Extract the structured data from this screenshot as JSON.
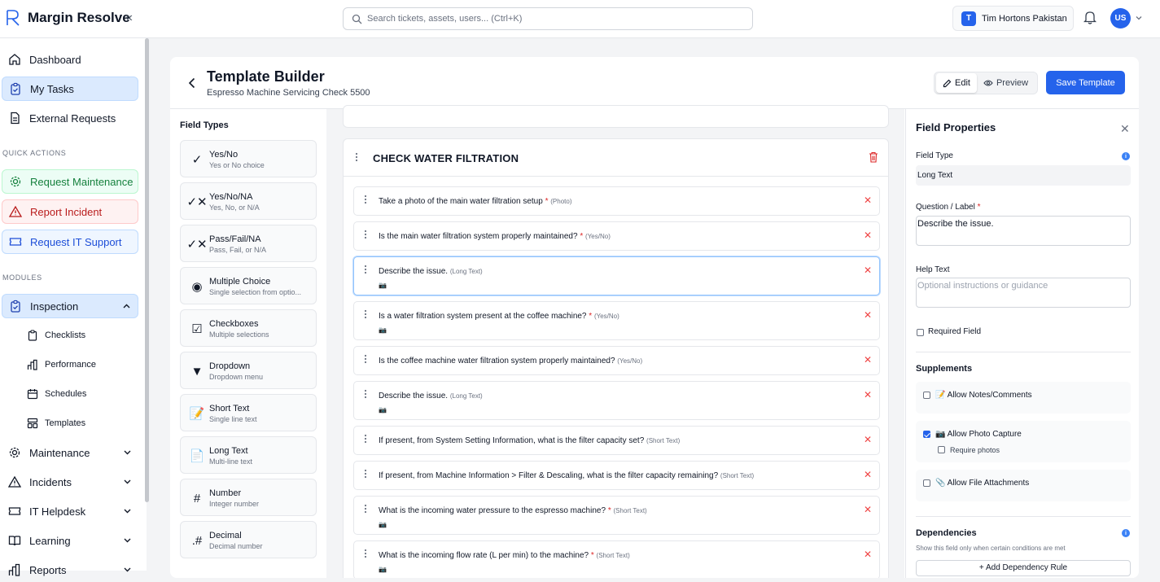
{
  "app": {
    "name": "Margin Resolve",
    "collapse_glyph": "«"
  },
  "search": {
    "placeholder": "Search tickets, assets, users... (Ctrl+K)"
  },
  "org": {
    "initial": "T",
    "name": "Tim Hortons Pakistan"
  },
  "user": {
    "initials": "US"
  },
  "sidebar": {
    "items": [
      {
        "label": "Dashboard",
        "icon": "home-icon"
      },
      {
        "label": "My Tasks",
        "icon": "clipboard-icon",
        "active": true
      },
      {
        "label": "External Requests",
        "icon": "document-icon"
      }
    ],
    "quick_actions_header": "QUICK ACTIONS",
    "quick_actions": [
      {
        "label": "Request Maintenance",
        "icon": "gear-icon",
        "color": "#15803d"
      },
      {
        "label": "Report Incident",
        "icon": "warning-icon",
        "color": "#b91c1c"
      },
      {
        "label": "Request IT Support",
        "icon": "ticket-icon",
        "color": "#1d4ed8"
      }
    ],
    "modules_header": "MODULES",
    "inspection": {
      "label": "Inspection",
      "expanded": true
    },
    "inspection_sub": [
      {
        "label": "Checklists",
        "icon": "clipboard-icon"
      },
      {
        "label": "Performance",
        "icon": "bar-chart-icon"
      },
      {
        "label": "Schedules",
        "icon": "calendar-icon"
      },
      {
        "label": "Templates",
        "icon": "layout-icon"
      }
    ],
    "modules": [
      {
        "label": "Maintenance",
        "icon": "gear-icon"
      },
      {
        "label": "Incidents",
        "icon": "warning-icon"
      },
      {
        "label": "IT Helpdesk",
        "icon": "ticket-icon"
      },
      {
        "label": "Learning",
        "icon": "book-icon"
      },
      {
        "label": "Reports",
        "icon": "bar-chart-icon"
      }
    ]
  },
  "builder": {
    "title": "Template Builder",
    "subtitle": "Espresso Machine Servicing Check 5500",
    "edit_label": "Edit",
    "preview_label": "Preview",
    "save_label": "Save Template"
  },
  "field_types": {
    "header": "Field Types",
    "items": [
      {
        "name": "Yes/No",
        "desc": "Yes or No choice",
        "icon": "✓"
      },
      {
        "name": "Yes/No/NA",
        "desc": "Yes, No, or N/A",
        "icon": "✓✕"
      },
      {
        "name": "Pass/Fail/NA",
        "desc": "Pass, Fail, or N/A",
        "icon": "✓✕"
      },
      {
        "name": "Multiple Choice",
        "desc": "Single selection from optio...",
        "icon": "◉"
      },
      {
        "name": "Checkboxes",
        "desc": "Multiple selections",
        "icon": "☑"
      },
      {
        "name": "Dropdown",
        "desc": "Dropdown menu",
        "icon": "▼"
      },
      {
        "name": "Short Text",
        "desc": "Single line text",
        "icon": "📝"
      },
      {
        "name": "Long Text",
        "desc": "Multi-line text",
        "icon": "📄"
      },
      {
        "name": "Number",
        "desc": "Integer number",
        "icon": "#"
      },
      {
        "name": "Decimal",
        "desc": "Decimal number",
        "icon": ".#"
      }
    ]
  },
  "section": {
    "title": "CHECK WATER FILTRATION",
    "questions": [
      {
        "text": "Take a photo of the main water filtration setup",
        "required": true,
        "type": "(Photo)",
        "camera": false
      },
      {
        "text": "Is the main water filtration system properly maintained?",
        "required": true,
        "type": "(Yes/No)",
        "camera": false
      },
      {
        "text": "Describe the issue.",
        "required": false,
        "type": "(Long Text)",
        "camera": true,
        "selected": true
      },
      {
        "text": "Is a water filtration system present at the coffee machine?",
        "required": true,
        "type": "(Yes/No)",
        "camera": true
      },
      {
        "text": "Is the coffee machine water filtration system properly maintained?",
        "required": false,
        "type": "(Yes/No)",
        "camera": false
      },
      {
        "text": "Describe the issue.",
        "required": false,
        "type": "(Long Text)",
        "camera": true
      },
      {
        "text": "If present, from System Setting Information, what is the filter capacity set?",
        "required": false,
        "type": "(Short Text)",
        "camera": false
      },
      {
        "text": "If present, from Machine Information > Filter & Descaling, what is the filter capacity remaining?",
        "required": false,
        "type": "(Short Text)",
        "camera": false
      },
      {
        "text": "What is the incoming water pressure to the espresso machine?",
        "required": true,
        "type": "(Short Text)",
        "camera": true
      },
      {
        "text": "What is the incoming flow rate (L per min) to the machine?",
        "required": true,
        "type": "(Short Text)",
        "camera": true
      }
    ]
  },
  "properties": {
    "title": "Field Properties",
    "field_type_label": "Field Type",
    "field_type_value": "Long Text",
    "question_label": "Question / Label",
    "question_value": "Describe the issue.",
    "help_label": "Help Text",
    "help_placeholder": "Optional instructions or guidance",
    "required_label": "Required Field",
    "required_checked": false,
    "supplements_header": "Supplements",
    "allow_notes": "📝 Allow Notes/Comments",
    "allow_notes_checked": false,
    "allow_photo": "📷 Allow Photo Capture",
    "allow_photo_checked": true,
    "require_photos": "Require photos",
    "require_photos_checked": false,
    "allow_files": "📎 Allow File Attachments",
    "allow_files_checked": false,
    "dependencies_header": "Dependencies",
    "dependencies_desc": "Show this field only when certain conditions are met",
    "add_dependency": "+ Add Dependency Rule"
  },
  "colors": {
    "accent": "#2563eb",
    "danger": "#dc2626",
    "success": "#15803d"
  }
}
